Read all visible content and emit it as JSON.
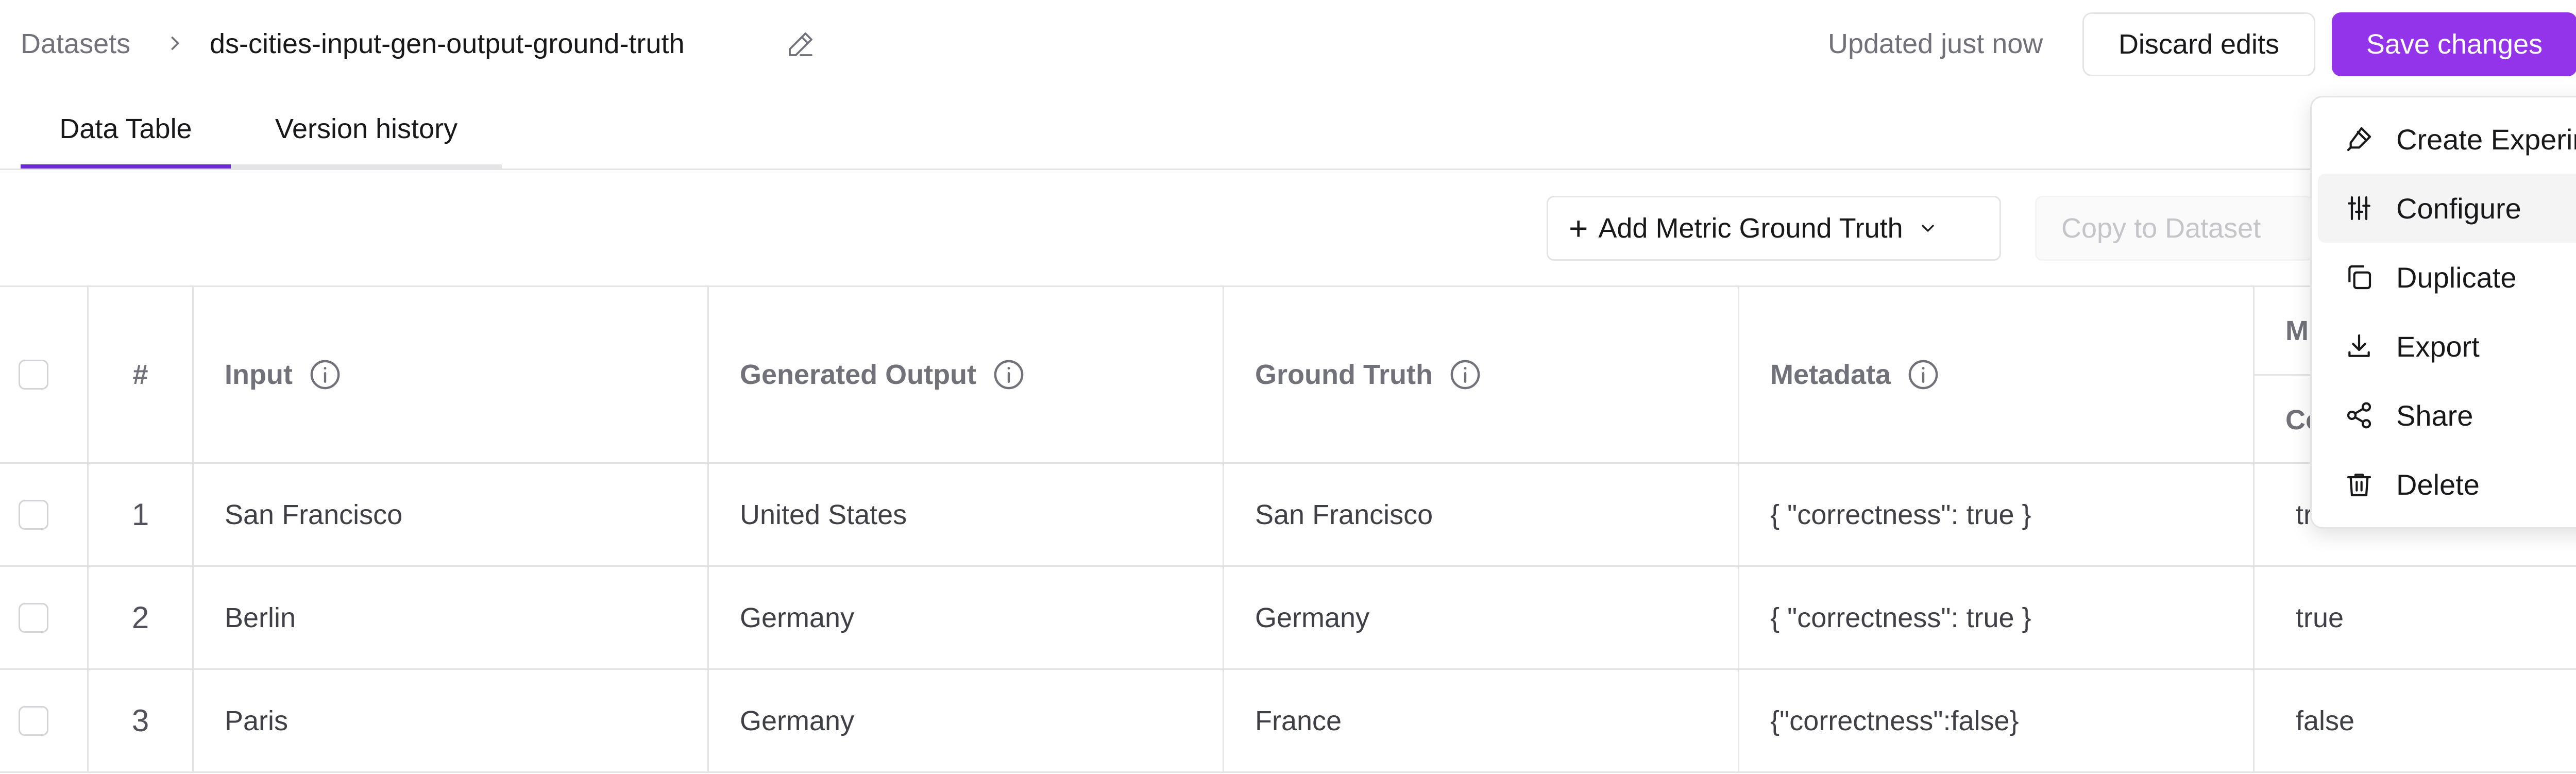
{
  "header": {
    "breadcrumb_root": "Datasets",
    "breadcrumb_current": "ds-cities-input-gen-output-ground-truth",
    "status": "Updated just now",
    "discard_label": "Discard edits",
    "save_label": "Save changes"
  },
  "tabs": [
    {
      "label": "Data Table",
      "active": true
    },
    {
      "label": "Version history",
      "active": false
    }
  ],
  "toolbar": {
    "add_metric_label": "Add Metric Ground Truth",
    "copy_label": "Copy to Dataset"
  },
  "table": {
    "columns": {
      "num": "#",
      "input": "Input",
      "generated_output": "Generated Output",
      "ground_truth": "Ground Truth",
      "metadata": "Metadata",
      "metric_group": "M",
      "metric_sub": "Co"
    },
    "rows": [
      {
        "num": "1",
        "input": "San Francisco",
        "generated_output": "United States",
        "ground_truth": "San Francisco",
        "metadata": "{ \"correctness\": true }",
        "metric": "tr"
      },
      {
        "num": "2",
        "input": "Berlin",
        "generated_output": "Germany",
        "ground_truth": "Germany",
        "metadata": "{ \"correctness\": true }",
        "metric": "true"
      },
      {
        "num": "3",
        "input": "Paris",
        "generated_output": "Germany",
        "ground_truth": "France",
        "metadata": "{\"correctness\":false}",
        "metric": "false"
      }
    ]
  },
  "menu": {
    "items": [
      {
        "label": "Create Experiment",
        "icon": "flask-icon"
      },
      {
        "label": "Configure",
        "icon": "sliders-icon",
        "highlighted": true
      },
      {
        "label": "Duplicate",
        "icon": "copy-icon"
      },
      {
        "label": "Export",
        "icon": "download-icon"
      },
      {
        "label": "Share",
        "icon": "share-icon"
      },
      {
        "label": "Delete",
        "icon": "trash-icon"
      }
    ]
  },
  "colors": {
    "accent": "#9333ea",
    "tab_underline": "#6d28d9",
    "border": "#e4e4e7",
    "muted_text": "#71717a"
  }
}
